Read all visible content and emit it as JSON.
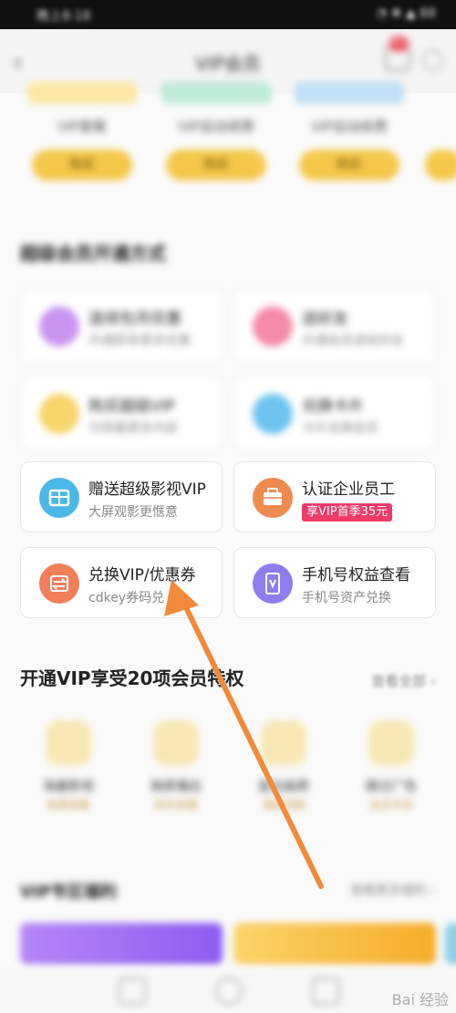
{
  "status_bar": {
    "left": "晚上8:18",
    "right": "◔ ❋ ▲ 88"
  },
  "nav": {
    "back_icon": "back-arrow-icon",
    "title": "VIP会员",
    "badge": "99+"
  },
  "packages": [
    {
      "name": "VIP套餐",
      "button": "购买"
    },
    {
      "name": "VIP自动续费",
      "button": "购买"
    },
    {
      "name": "VIP自动续费",
      "button": "购买"
    }
  ],
  "sections": {
    "more_ways": "超级会员开通方式",
    "privileges_title": "开通VIP享受20项会员特权",
    "see_all": "查看全部 ›",
    "vip_zone": "VIP专区福利",
    "vip_zone_more": "查看更多福利 ›"
  },
  "ways": [
    {
      "title": "连续包月优惠",
      "subtitle": "开通即享更多优惠",
      "color": "#c994f0"
    },
    {
      "title": "送好友",
      "subtitle": "开通会员送给好友",
      "color": "#f48aa7"
    },
    {
      "title": "购买超级VIP",
      "subtitle": "可观看更多内容",
      "color": "#f7d56a"
    },
    {
      "title": "兑换卡片",
      "subtitle": "卡片兑换会员",
      "color": "#6cc3f0"
    }
  ],
  "actions": [
    {
      "title": "赠送超级影视VIP",
      "subtitle": "大屏观影更惬意",
      "icon": "gift-card-icon",
      "color": "#4ab8e8"
    },
    {
      "title": "认证企业员工",
      "badge": "享VIP首季35元",
      "icon": "briefcase-icon",
      "color": "#f08a4e"
    },
    {
      "title": "兑换VIP/优惠券",
      "subtitle": "cdkey券码兑",
      "icon": "exchange-arrows-icon",
      "color": "#f27e5a"
    },
    {
      "title": "手机号权益查看",
      "subtitle": "手机号资产兑换",
      "icon": "phone-v-icon",
      "color": "#8c7ef0"
    }
  ],
  "privileges": [
    {
      "name": "海量影视",
      "sub": "免费观看"
    },
    {
      "name": "独家播出",
      "sub": "抢先观看"
    },
    {
      "name": "蓝光画质",
      "sub": "清晰流畅"
    },
    {
      "name": "跳过广告",
      "sub": "会员专享"
    }
  ],
  "watermark": "Bai 经验"
}
